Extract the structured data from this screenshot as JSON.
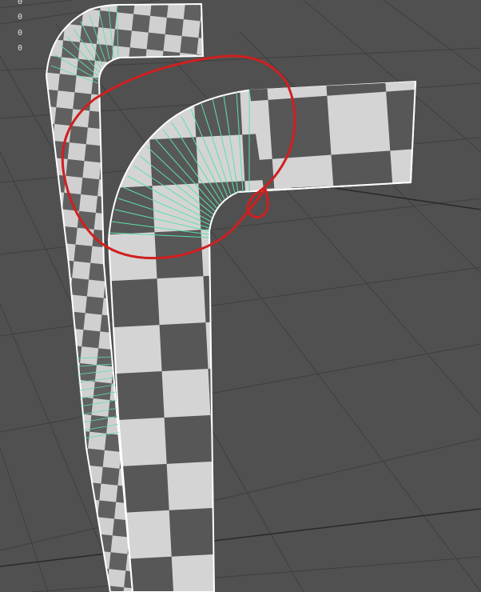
{
  "viewport": {
    "type": "3d-modeling-viewport",
    "background_color": "#505050",
    "grid_color": "#3f3f3f",
    "checker_light": "#d0d0d0",
    "checker_dark": "#555555",
    "edge_highlight": "#ffffff",
    "edge_loop_color": "#5ee0a8",
    "annotation_color": "#d11f1f",
    "annotation_shape": "hand-drawn circle",
    "objects": [
      {
        "name": "bent-pipe-back",
        "texture": "checker",
        "edge_loops_highlighted": true
      },
      {
        "name": "bent-pipe-front",
        "texture": "checker",
        "edge_loops_highlighted": true
      }
    ]
  },
  "hud": {
    "stats": [
      "0",
      "0",
      "0",
      "0"
    ]
  }
}
